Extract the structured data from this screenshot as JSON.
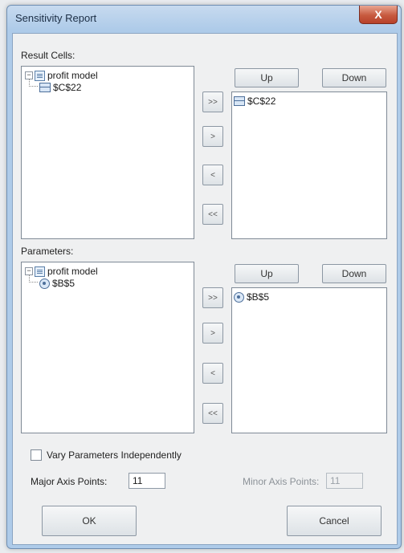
{
  "window": {
    "title": "Sensitivity Report",
    "close_glyph": "X"
  },
  "result_cells": {
    "label": "Result Cells:",
    "tree_root": "profit model",
    "tree_child": "$C$22",
    "selected": [
      "$C$22"
    ],
    "up_label": "Up",
    "down_label": "Down"
  },
  "parameters": {
    "label": "Parameters:",
    "tree_root": "profit model",
    "tree_child": "$B$5",
    "selected": [
      "$B$5"
    ],
    "up_label": "Up",
    "down_label": "Down"
  },
  "transfer_buttons": {
    "add_all": ">>",
    "add": ">",
    "remove": "<",
    "remove_all": "<<"
  },
  "options": {
    "vary_label": "Vary Parameters Independently",
    "vary_checked": false,
    "major_label": "Major Axis Points:",
    "major_value": "11",
    "minor_label": "Minor Axis Points:",
    "minor_value": "11"
  },
  "footer": {
    "ok_label": "OK",
    "cancel_label": "Cancel"
  }
}
